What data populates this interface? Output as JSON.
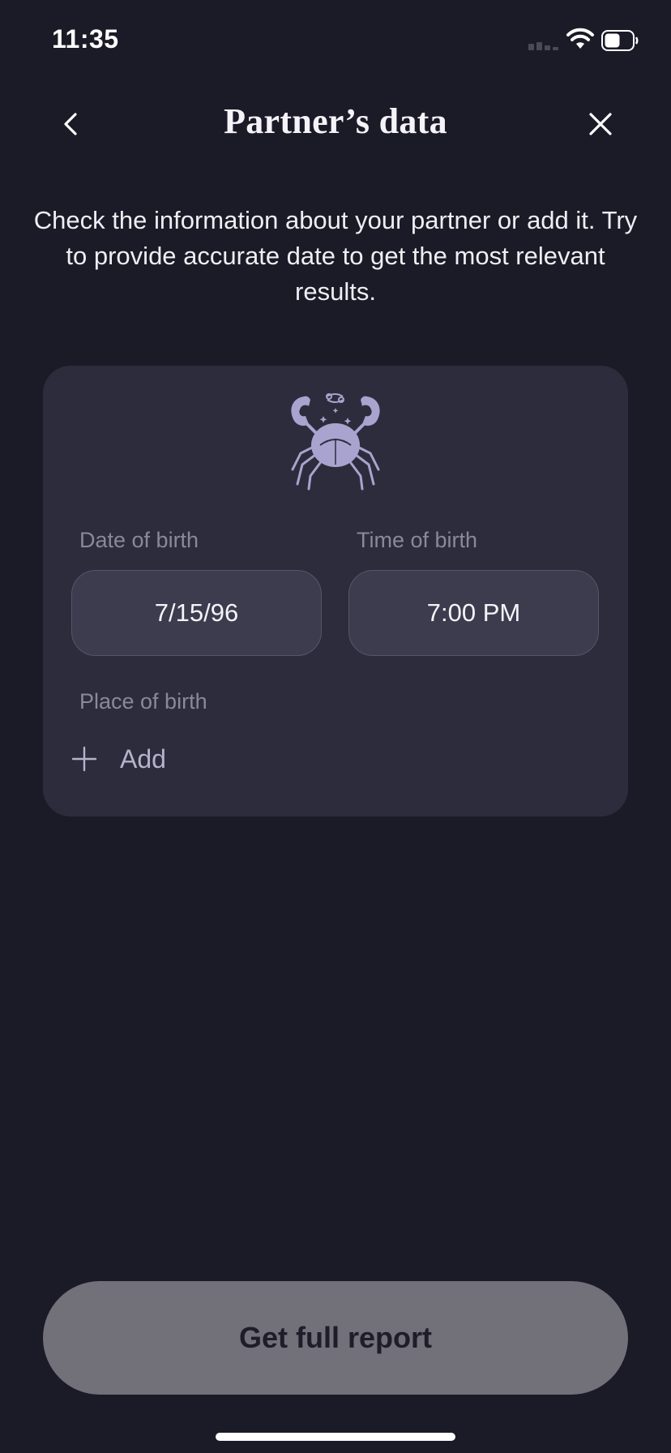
{
  "status_bar": {
    "time": "11:35"
  },
  "header": {
    "title": "Partner’s data",
    "back_icon": "chevron-left-icon",
    "close_icon": "close-icon"
  },
  "intro": {
    "text": "Check the information about your partner or add it. Try to provide accurate date to get the most relevant results."
  },
  "card": {
    "zodiac_icon": "cancer-crab-icon",
    "date_of_birth": {
      "label": "Date of birth",
      "value": "7/15/96"
    },
    "time_of_birth": {
      "label": "Time of birth",
      "value": "7:00 PM"
    },
    "place_of_birth": {
      "label": "Place of birth",
      "add_label": "Add"
    }
  },
  "cta": {
    "label": "Get full report"
  },
  "colors": {
    "background": "#1b1a27",
    "card": "#2d2c3c",
    "picker": "#3d3c4e",
    "accent_lavender": "#a9a3cf",
    "cta_disabled": "#727079"
  }
}
